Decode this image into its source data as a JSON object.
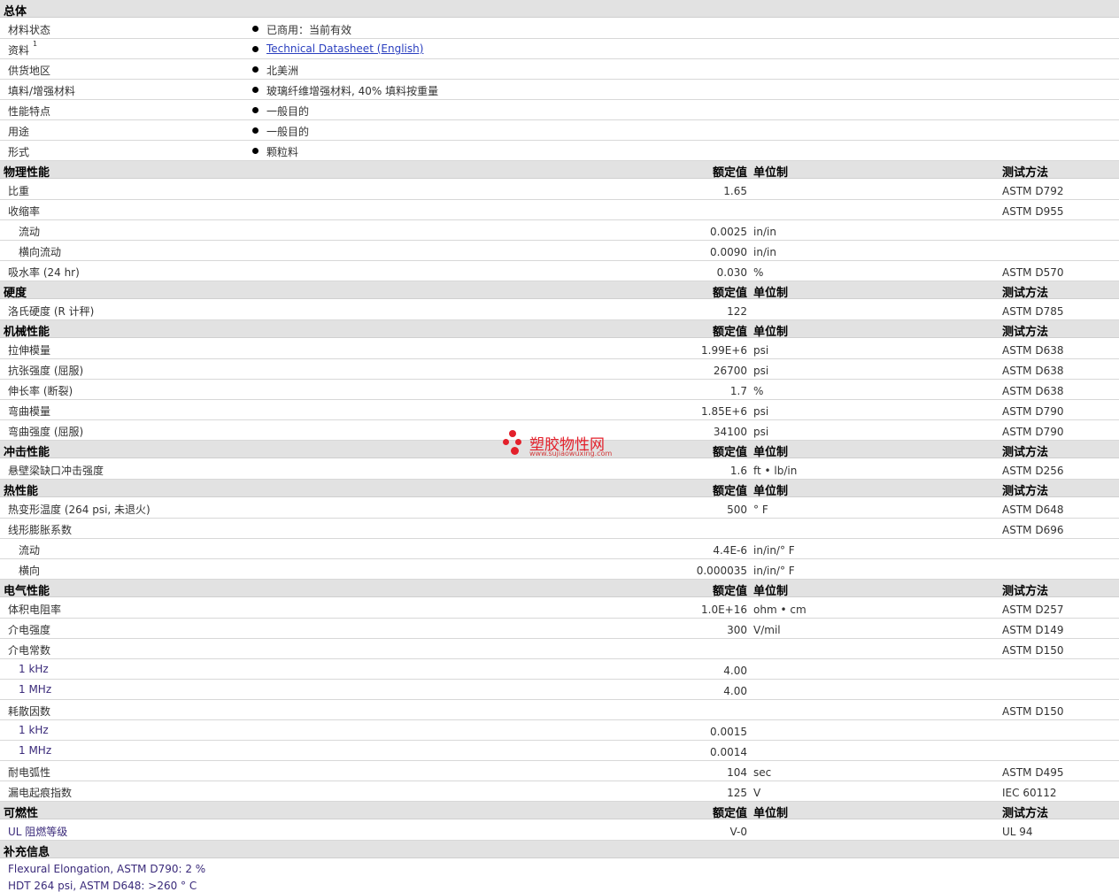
{
  "general": {
    "title": "总体",
    "rows": [
      {
        "label": "材料状态",
        "value": "已商用：当前有效"
      },
      {
        "label": "资料",
        "sup": "1",
        "link": "Technical Datasheet (English)"
      },
      {
        "label": "供货地区",
        "value": "北美洲"
      },
      {
        "label": "填料/增强材料",
        "value": "玻璃纤维增强材料, 40% 填料按重量"
      },
      {
        "label": "性能特点",
        "value": "一般目的"
      },
      {
        "label": "用途",
        "value": "一般目的"
      },
      {
        "label": "形式",
        "value": "颗粒料"
      }
    ]
  },
  "columns": {
    "nominal": "额定值",
    "unit": "单位制",
    "test": "测试方法"
  },
  "sections": [
    {
      "title": "物理性能",
      "rows": [
        {
          "label": "比重",
          "value": "1.65",
          "unit": "",
          "test": "ASTM D792"
        },
        {
          "label": "收缩率",
          "value": "",
          "unit": "",
          "test": "ASTM D955"
        },
        {
          "label": "流动",
          "value": "0.0025",
          "unit": "in/in",
          "test": "",
          "sub": true
        },
        {
          "label": "横向流动",
          "value": "0.0090",
          "unit": "in/in",
          "test": "",
          "sub": true
        },
        {
          "label": "吸水率 (24 hr)",
          "value": "0.030",
          "unit": "%",
          "test": "ASTM D570"
        }
      ]
    },
    {
      "title": "硬度",
      "rows": [
        {
          "label": "洛氏硬度 (R 计秤)",
          "value": "122",
          "unit": "",
          "test": "ASTM D785"
        }
      ]
    },
    {
      "title": "机械性能",
      "rows": [
        {
          "label": "拉伸模量",
          "value": "1.99E+6",
          "unit": "psi",
          "test": "ASTM D638"
        },
        {
          "label": "抗张强度 (屈服)",
          "value": "26700",
          "unit": "psi",
          "test": "ASTM D638"
        },
        {
          "label": "伸长率 (断裂)",
          "value": "1.7",
          "unit": "%",
          "test": "ASTM D638"
        },
        {
          "label": "弯曲模量",
          "value": "1.85E+6",
          "unit": "psi",
          "test": "ASTM D790"
        },
        {
          "label": "弯曲强度 (屈服)",
          "value": "34100",
          "unit": "psi",
          "test": "ASTM D790"
        }
      ]
    },
    {
      "title": "冲击性能",
      "rows": [
        {
          "label": "悬壁梁缺口冲击强度",
          "value": "1.6",
          "unit": "ft • lb/in",
          "test": "ASTM D256"
        }
      ]
    },
    {
      "title": "热性能",
      "rows": [
        {
          "label": "热变形温度 (264 psi, 未退火)",
          "value": "500",
          "unit": "° F",
          "test": "ASTM D648"
        },
        {
          "label": "线形膨胀系数",
          "value": "",
          "unit": "",
          "test": "ASTM D696"
        },
        {
          "label": "流动",
          "value": "4.4E-6",
          "unit": "in/in/° F",
          "test": "",
          "sub": true
        },
        {
          "label": "横向",
          "value": "0.000035",
          "unit": "in/in/° F",
          "test": "",
          "sub": true
        }
      ]
    },
    {
      "title": "电气性能",
      "rows": [
        {
          "label": "体积电阻率",
          "value": "1.0E+16",
          "unit": "ohm • cm",
          "test": "ASTM D257"
        },
        {
          "label": "介电强度",
          "value": "300",
          "unit": "V/mil",
          "test": "ASTM D149"
        },
        {
          "label": "介电常数",
          "value": "",
          "unit": "",
          "test": "ASTM D150"
        },
        {
          "label": "1 kHz",
          "value": "4.00",
          "unit": "",
          "test": "",
          "sub": true,
          "purple": true
        },
        {
          "label": "1 MHz",
          "value": "4.00",
          "unit": "",
          "test": "",
          "sub": true,
          "purple": true
        },
        {
          "label": "耗散因数",
          "value": "",
          "unit": "",
          "test": "ASTM D150"
        },
        {
          "label": "1 kHz",
          "value": "0.0015",
          "unit": "",
          "test": "",
          "sub": true,
          "purple": true
        },
        {
          "label": "1 MHz",
          "value": "0.0014",
          "unit": "",
          "test": "",
          "sub": true,
          "purple": true
        },
        {
          "label": "耐电弧性",
          "value": "104",
          "unit": "sec",
          "test": "ASTM D495"
        },
        {
          "label": "漏电起痕指数",
          "value": "125",
          "unit": "V",
          "test": "IEC 60112"
        }
      ]
    },
    {
      "title": "可燃性",
      "rows": [
        {
          "label": "UL 阻燃等级",
          "value": "V-0",
          "unit": "",
          "test": "UL 94",
          "purple": true
        }
      ]
    }
  ],
  "supplement": {
    "title": "补充信息",
    "notes": [
      "Flexural Elongation, ASTM D790: 2 %",
      "HDT 264 psi, ASTM D648: >260 °  C"
    ]
  },
  "watermark": {
    "title": "塑胶物性网",
    "url": "www.sujiaowuxing.com"
  }
}
